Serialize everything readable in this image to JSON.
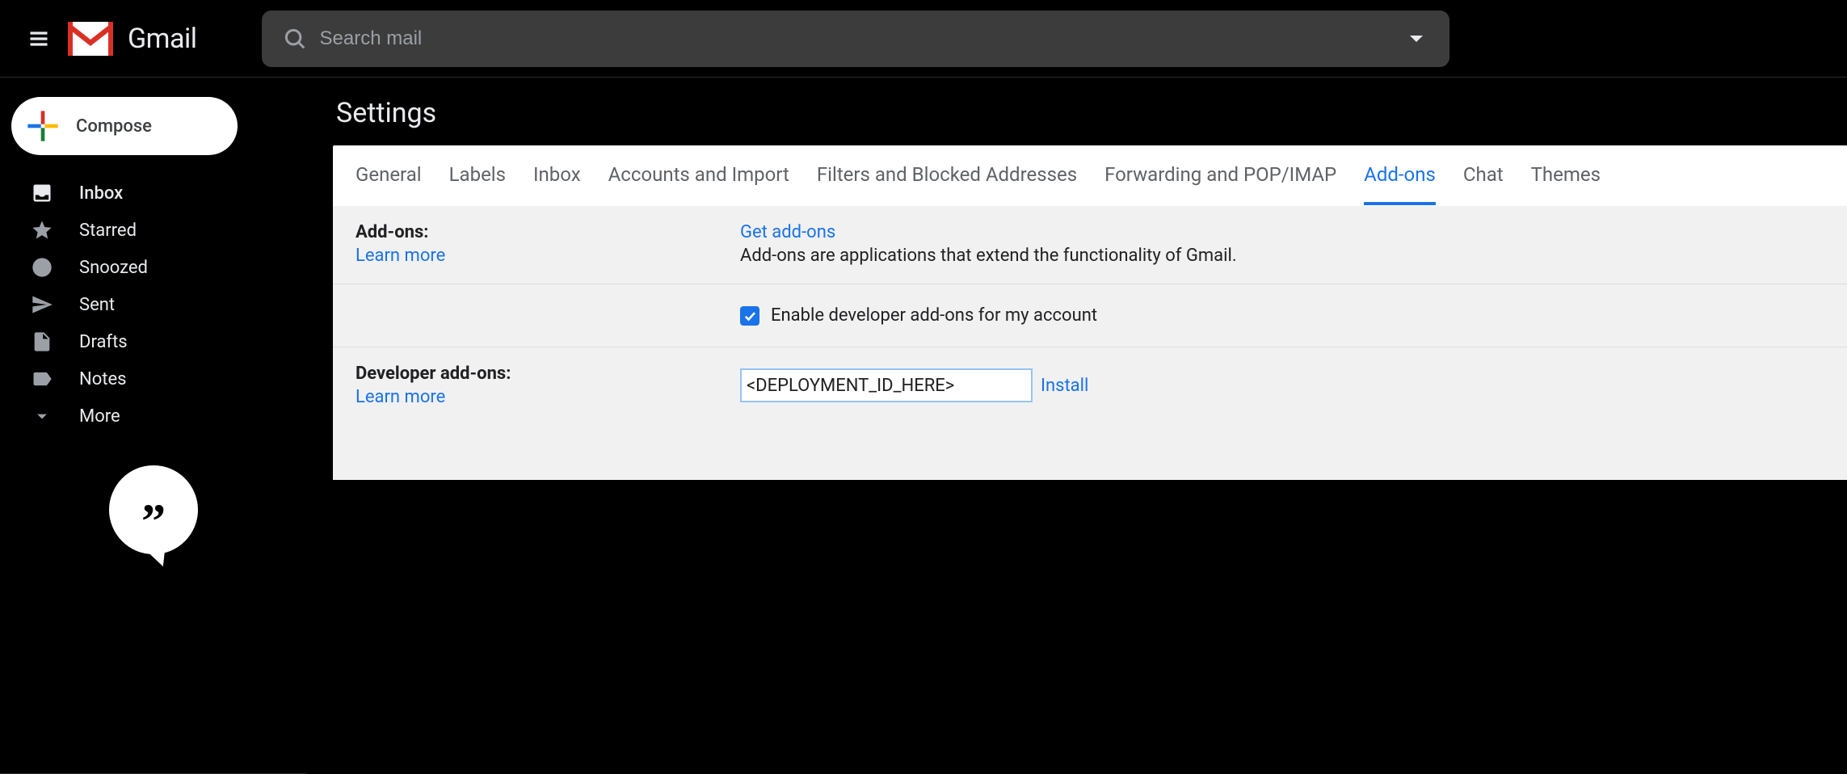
{
  "header": {
    "product_name": "Gmail",
    "search_placeholder": "Search mail"
  },
  "sidebar": {
    "compose_label": "Compose",
    "items": [
      {
        "label": "Inbox"
      },
      {
        "label": "Starred"
      },
      {
        "label": "Snoozed"
      },
      {
        "label": "Sent"
      },
      {
        "label": "Drafts"
      },
      {
        "label": "Notes"
      },
      {
        "label": "More"
      }
    ]
  },
  "settings": {
    "page_title": "Settings",
    "tabs": [
      "General",
      "Labels",
      "Inbox",
      "Accounts and Import",
      "Filters and Blocked Addresses",
      "Forwarding and POP/IMAP",
      "Add-ons",
      "Chat",
      "Themes"
    ],
    "active_tab": "Add-ons",
    "addons": {
      "section_label": "Add-ons:",
      "learn_more": "Learn more",
      "get_addons": "Get add-ons",
      "description": "Add-ons are applications that extend the functionality of Gmail.",
      "enable_label": "Enable developer add-ons for my account",
      "enable_checked": true
    },
    "developer": {
      "section_label": "Developer add-ons:",
      "learn_more": "Learn more",
      "input_value": "<DEPLOYMENT_ID_HERE>",
      "install_label": "Install"
    }
  }
}
